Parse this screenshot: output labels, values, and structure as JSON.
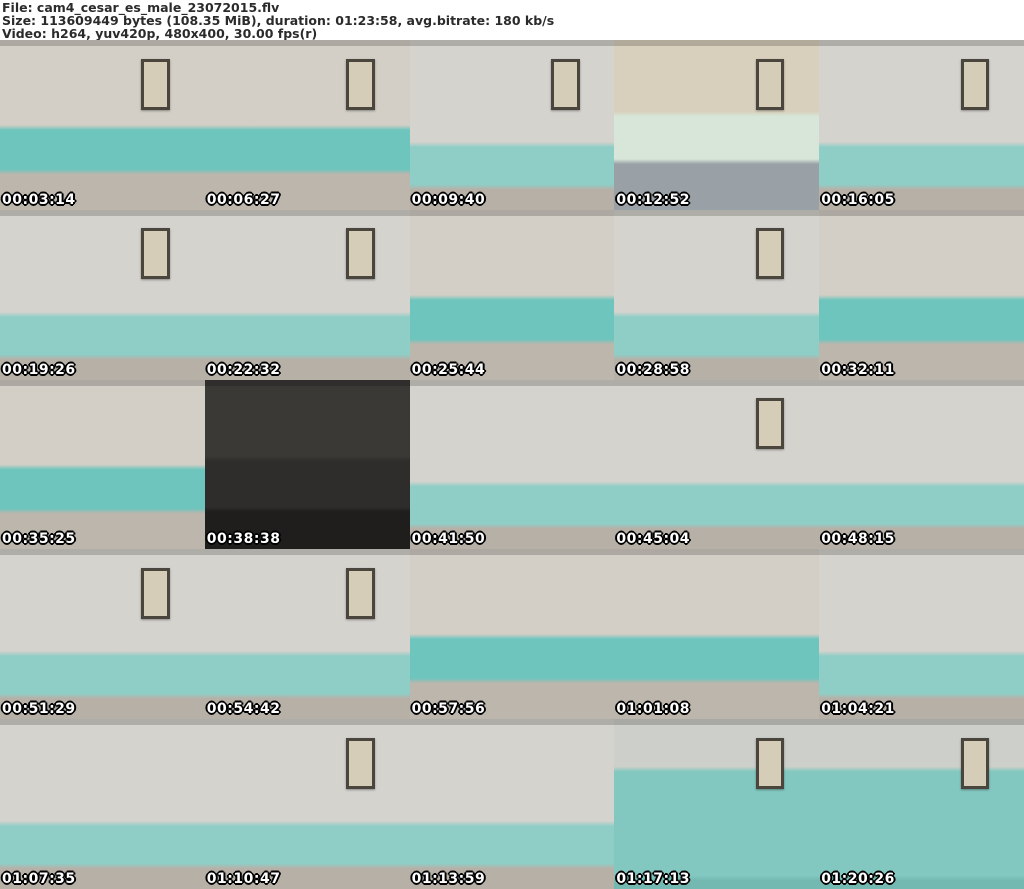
{
  "header": {
    "file_line": "File: cam4_cesar_es_male_23072015.flv",
    "size_line": "Size: 113609449 bytes (108.35 MiB), duration: 01:23:58, avg.bitrate: 180 kb/s",
    "video_line": "Video: h264, yuv420p, 480x400, 30.00 fps(r)"
  },
  "grid": {
    "columns": 5,
    "rows": 5,
    "timestamp_style": {
      "fill": "#ffffff",
      "outline": "#000000"
    },
    "variants": {
      "aqua-band": {
        "top": "#d3cfc6",
        "band": "#6ec5bd",
        "bottom": "#bdb6ac",
        "s1": "50%",
        "s2": "76%"
      },
      "gray-frame": {
        "top": "#d5d3ce",
        "band": "#8fcec6",
        "bottom": "#b7b0a7",
        "s1": "60%",
        "s2": "85%"
      },
      "dark": {
        "top": "#3a3936",
        "band": "#2e2d2b",
        "bottom": "#1f1e1c",
        "s1": "45%",
        "s2": "75%"
      },
      "desk": {
        "top": "#d8d0bd",
        "band": "#d7e6d8",
        "bottom": "#9aa1a6",
        "s1": "42%",
        "s2": "70%"
      },
      "teal-room": {
        "top": "#cdcfca",
        "band": "#82c8c0",
        "bottom": "#74b9b1",
        "s1": "28%",
        "s2": "92%"
      }
    },
    "thumbnails": [
      {
        "timestamp": "00:03:14",
        "variant": "aqua-band",
        "frame": true
      },
      {
        "timestamp": "00:06:27",
        "variant": "aqua-band",
        "frame": true
      },
      {
        "timestamp": "00:09:40",
        "variant": "gray-frame",
        "frame": true
      },
      {
        "timestamp": "00:12:52",
        "variant": "desk",
        "frame": true
      },
      {
        "timestamp": "00:16:05",
        "variant": "gray-frame",
        "frame": true
      },
      {
        "timestamp": "00:19:26",
        "variant": "gray-frame",
        "frame": true
      },
      {
        "timestamp": "00:22:32",
        "variant": "gray-frame",
        "frame": true
      },
      {
        "timestamp": "00:25:44",
        "variant": "aqua-band",
        "frame": false
      },
      {
        "timestamp": "00:28:58",
        "variant": "gray-frame",
        "frame": true
      },
      {
        "timestamp": "00:32:11",
        "variant": "aqua-band",
        "frame": false
      },
      {
        "timestamp": "00:35:25",
        "variant": "aqua-band",
        "frame": false
      },
      {
        "timestamp": "00:38:38",
        "variant": "dark",
        "frame": false
      },
      {
        "timestamp": "00:41:50",
        "variant": "gray-frame",
        "frame": false
      },
      {
        "timestamp": "00:45:04",
        "variant": "gray-frame",
        "frame": true
      },
      {
        "timestamp": "00:48:15",
        "variant": "gray-frame",
        "frame": false
      },
      {
        "timestamp": "00:51:29",
        "variant": "gray-frame",
        "frame": true
      },
      {
        "timestamp": "00:54:42",
        "variant": "gray-frame",
        "frame": true
      },
      {
        "timestamp": "00:57:56",
        "variant": "aqua-band",
        "frame": false
      },
      {
        "timestamp": "01:01:08",
        "variant": "aqua-band",
        "frame": false
      },
      {
        "timestamp": "01:04:21",
        "variant": "gray-frame",
        "frame": false
      },
      {
        "timestamp": "01:07:35",
        "variant": "gray-frame",
        "frame": false
      },
      {
        "timestamp": "01:10:47",
        "variant": "gray-frame",
        "frame": true
      },
      {
        "timestamp": "01:13:59",
        "variant": "gray-frame",
        "frame": false
      },
      {
        "timestamp": "01:17:13",
        "variant": "teal-room",
        "frame": true
      },
      {
        "timestamp": "01:20:26",
        "variant": "teal-room",
        "frame": true
      }
    ]
  }
}
